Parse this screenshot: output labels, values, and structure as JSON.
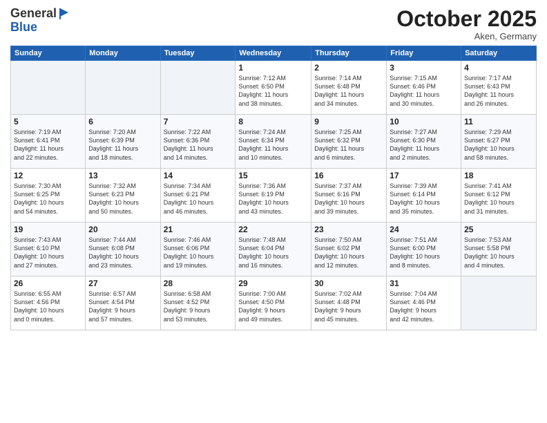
{
  "logo": {
    "general": "General",
    "blue": "Blue"
  },
  "title": "October 2025",
  "location": "Aken, Germany",
  "days_of_week": [
    "Sunday",
    "Monday",
    "Tuesday",
    "Wednesday",
    "Thursday",
    "Friday",
    "Saturday"
  ],
  "weeks": [
    [
      {
        "day": "",
        "info": ""
      },
      {
        "day": "",
        "info": ""
      },
      {
        "day": "",
        "info": ""
      },
      {
        "day": "1",
        "info": "Sunrise: 7:12 AM\nSunset: 6:50 PM\nDaylight: 11 hours\nand 38 minutes."
      },
      {
        "day": "2",
        "info": "Sunrise: 7:14 AM\nSunset: 6:48 PM\nDaylight: 11 hours\nand 34 minutes."
      },
      {
        "day": "3",
        "info": "Sunrise: 7:15 AM\nSunset: 6:46 PM\nDaylight: 11 hours\nand 30 minutes."
      },
      {
        "day": "4",
        "info": "Sunrise: 7:17 AM\nSunset: 6:43 PM\nDaylight: 11 hours\nand 26 minutes."
      }
    ],
    [
      {
        "day": "5",
        "info": "Sunrise: 7:19 AM\nSunset: 6:41 PM\nDaylight: 11 hours\nand 22 minutes."
      },
      {
        "day": "6",
        "info": "Sunrise: 7:20 AM\nSunset: 6:39 PM\nDaylight: 11 hours\nand 18 minutes."
      },
      {
        "day": "7",
        "info": "Sunrise: 7:22 AM\nSunset: 6:36 PM\nDaylight: 11 hours\nand 14 minutes."
      },
      {
        "day": "8",
        "info": "Sunrise: 7:24 AM\nSunset: 6:34 PM\nDaylight: 11 hours\nand 10 minutes."
      },
      {
        "day": "9",
        "info": "Sunrise: 7:25 AM\nSunset: 6:32 PM\nDaylight: 11 hours\nand 6 minutes."
      },
      {
        "day": "10",
        "info": "Sunrise: 7:27 AM\nSunset: 6:30 PM\nDaylight: 11 hours\nand 2 minutes."
      },
      {
        "day": "11",
        "info": "Sunrise: 7:29 AM\nSunset: 6:27 PM\nDaylight: 10 hours\nand 58 minutes."
      }
    ],
    [
      {
        "day": "12",
        "info": "Sunrise: 7:30 AM\nSunset: 6:25 PM\nDaylight: 10 hours\nand 54 minutes."
      },
      {
        "day": "13",
        "info": "Sunrise: 7:32 AM\nSunset: 6:23 PM\nDaylight: 10 hours\nand 50 minutes."
      },
      {
        "day": "14",
        "info": "Sunrise: 7:34 AM\nSunset: 6:21 PM\nDaylight: 10 hours\nand 46 minutes."
      },
      {
        "day": "15",
        "info": "Sunrise: 7:36 AM\nSunset: 6:19 PM\nDaylight: 10 hours\nand 43 minutes."
      },
      {
        "day": "16",
        "info": "Sunrise: 7:37 AM\nSunset: 6:16 PM\nDaylight: 10 hours\nand 39 minutes."
      },
      {
        "day": "17",
        "info": "Sunrise: 7:39 AM\nSunset: 6:14 PM\nDaylight: 10 hours\nand 35 minutes."
      },
      {
        "day": "18",
        "info": "Sunrise: 7:41 AM\nSunset: 6:12 PM\nDaylight: 10 hours\nand 31 minutes."
      }
    ],
    [
      {
        "day": "19",
        "info": "Sunrise: 7:43 AM\nSunset: 6:10 PM\nDaylight: 10 hours\nand 27 minutes."
      },
      {
        "day": "20",
        "info": "Sunrise: 7:44 AM\nSunset: 6:08 PM\nDaylight: 10 hours\nand 23 minutes."
      },
      {
        "day": "21",
        "info": "Sunrise: 7:46 AM\nSunset: 6:06 PM\nDaylight: 10 hours\nand 19 minutes."
      },
      {
        "day": "22",
        "info": "Sunrise: 7:48 AM\nSunset: 6:04 PM\nDaylight: 10 hours\nand 16 minutes."
      },
      {
        "day": "23",
        "info": "Sunrise: 7:50 AM\nSunset: 6:02 PM\nDaylight: 10 hours\nand 12 minutes."
      },
      {
        "day": "24",
        "info": "Sunrise: 7:51 AM\nSunset: 6:00 PM\nDaylight: 10 hours\nand 8 minutes."
      },
      {
        "day": "25",
        "info": "Sunrise: 7:53 AM\nSunset: 5:58 PM\nDaylight: 10 hours\nand 4 minutes."
      }
    ],
    [
      {
        "day": "26",
        "info": "Sunrise: 6:55 AM\nSunset: 4:56 PM\nDaylight: 10 hours\nand 0 minutes."
      },
      {
        "day": "27",
        "info": "Sunrise: 6:57 AM\nSunset: 4:54 PM\nDaylight: 9 hours\nand 57 minutes."
      },
      {
        "day": "28",
        "info": "Sunrise: 6:58 AM\nSunset: 4:52 PM\nDaylight: 9 hours\nand 53 minutes."
      },
      {
        "day": "29",
        "info": "Sunrise: 7:00 AM\nSunset: 4:50 PM\nDaylight: 9 hours\nand 49 minutes."
      },
      {
        "day": "30",
        "info": "Sunrise: 7:02 AM\nSunset: 4:48 PM\nDaylight: 9 hours\nand 45 minutes."
      },
      {
        "day": "31",
        "info": "Sunrise: 7:04 AM\nSunset: 4:46 PM\nDaylight: 9 hours\nand 42 minutes."
      },
      {
        "day": "",
        "info": ""
      }
    ]
  ]
}
